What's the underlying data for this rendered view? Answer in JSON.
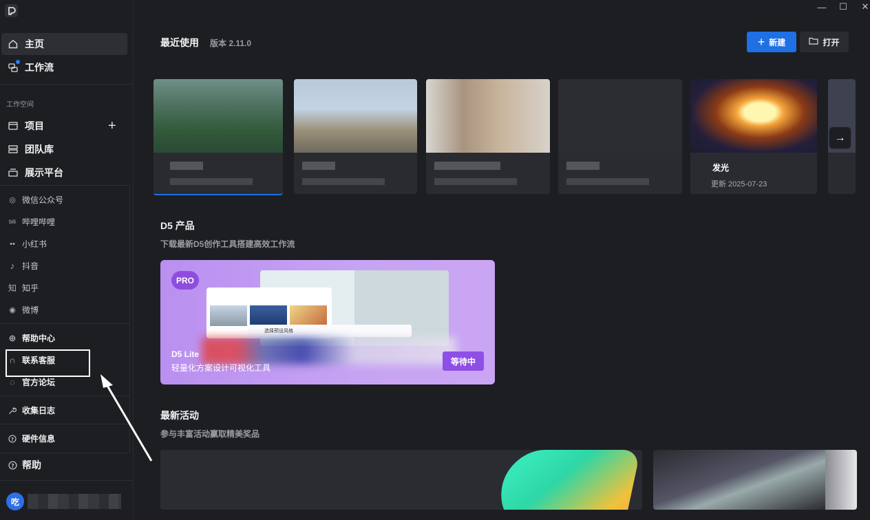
{
  "window": {
    "minimize": "—",
    "maximize": "☐",
    "close": "✕"
  },
  "sidebar": {
    "nav": [
      {
        "label": "主页",
        "icon": "home-icon"
      },
      {
        "label": "工作流",
        "icon": "workflow-icon"
      }
    ],
    "workspace_label": "工作空间",
    "workspace": [
      {
        "label": "项目",
        "icon": "project-icon"
      },
      {
        "label": "团队库",
        "icon": "library-icon"
      },
      {
        "label": "展示平台",
        "icon": "showcase-icon"
      }
    ],
    "add_symbol": "+",
    "social": [
      {
        "label": "微信公众号",
        "icon": "wechat-icon",
        "glyph": "◎"
      },
      {
        "label": "哔哩哔哩",
        "icon": "bilibili-icon",
        "glyph": "bili"
      },
      {
        "label": "小红书",
        "icon": "xiaohongshu-icon",
        "glyph": "••"
      },
      {
        "label": "抖音",
        "icon": "douyin-icon",
        "glyph": "♪"
      },
      {
        "label": "知乎",
        "icon": "zhihu-icon",
        "glyph": "知"
      },
      {
        "label": "微博",
        "icon": "weibo-icon",
        "glyph": "◉"
      }
    ],
    "support": [
      {
        "label": "帮助中心",
        "icon": "help-center-icon",
        "glyph": "⊕"
      },
      {
        "label": "联系客服",
        "icon": "headset-icon",
        "glyph": "∩"
      },
      {
        "label": "官方论坛",
        "icon": "forum-icon",
        "glyph": "◌"
      }
    ],
    "collect_logs": "收集日志",
    "hardware_info": "硬件信息",
    "help": "帮助",
    "avatar_initial": "吃"
  },
  "main": {
    "recent_title": "最近使用",
    "version": "版本 2.11.0",
    "new_button": "新建",
    "open_button": "打开",
    "recent_cards": [
      {
        "title": "",
        "date": ""
      },
      {
        "title": "",
        "date": ""
      },
      {
        "title": "",
        "date": ""
      },
      {
        "title": "",
        "date": ""
      },
      {
        "title": "发光",
        "date": "更新 2025-07-23"
      },
      {
        "title": "",
        "date": ""
      }
    ],
    "products_title": "D5 产品",
    "products_sub": "下载最新D5创作工具搭建高效工作流",
    "banner": {
      "badge": "PRO",
      "name": "D5 Lite",
      "desc": "轻量化方案设计可视化工具",
      "button": "等待中",
      "mock_style_label": "选择预设风格"
    },
    "activities_title": "最新活动",
    "activities_sub": "参与丰富活动赢取精美奖品"
  },
  "colors": {
    "accent": "#1f6fe5",
    "banner": "#c7a4f3",
    "pro": "#8f4de0"
  }
}
